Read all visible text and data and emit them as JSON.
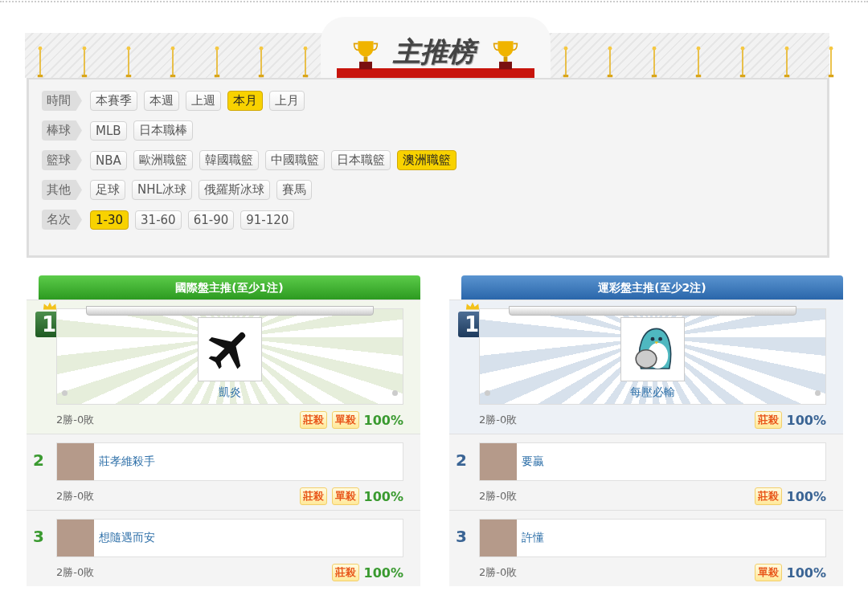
{
  "title": "主推榜",
  "filters": [
    {
      "label": "時間",
      "options": [
        {
          "label": "本賽季",
          "selected": false
        },
        {
          "label": "本週",
          "selected": false
        },
        {
          "label": "上週",
          "selected": false
        },
        {
          "label": "本月",
          "selected": true
        },
        {
          "label": "上月",
          "selected": false
        }
      ]
    },
    {
      "label": "棒球",
      "options": [
        {
          "label": "MLB",
          "selected": false
        },
        {
          "label": "日本職棒",
          "selected": false
        }
      ]
    },
    {
      "label": "籃球",
      "options": [
        {
          "label": "NBA",
          "selected": false
        },
        {
          "label": "歐洲職籃",
          "selected": false
        },
        {
          "label": "韓國職籃",
          "selected": false
        },
        {
          "label": "中國職籃",
          "selected": false
        },
        {
          "label": "日本職籃",
          "selected": false
        },
        {
          "label": "澳洲職籃",
          "selected": true
        }
      ]
    },
    {
      "label": "其他",
      "options": [
        {
          "label": "足球",
          "selected": false
        },
        {
          "label": "NHL冰球",
          "selected": false
        },
        {
          "label": "俄羅斯冰球",
          "selected": false
        },
        {
          "label": "賽馬",
          "selected": false
        }
      ]
    },
    {
      "label": "名次",
      "options": [
        {
          "label": "1-30",
          "selected": true
        },
        {
          "label": "31-60",
          "selected": false
        },
        {
          "label": "61-90",
          "selected": false
        },
        {
          "label": "91-120",
          "selected": false
        }
      ]
    }
  ],
  "boards": [
    {
      "kind": "green",
      "title": "國際盤主推(至少1注)",
      "entries": [
        {
          "rank": "1",
          "avatar": {
            "kind": "plane"
          },
          "name": "凱炎",
          "record": "2勝-0敗",
          "tags": [
            "莊殺",
            "單殺"
          ],
          "rate": "100%"
        },
        {
          "rank": "2",
          "avatar": {
            "kind": "photo"
          },
          "name": "莊孝維殺手",
          "record": "2勝-0敗",
          "tags": [
            "莊殺",
            "單殺"
          ],
          "rate": "100%"
        },
        {
          "rank": "3",
          "avatar": {
            "kind": "photo"
          },
          "name": "想隨遇而安",
          "record": "2勝-0敗",
          "tags": [
            "莊殺"
          ],
          "rate": "100%"
        }
      ]
    },
    {
      "kind": "blue",
      "title": "運彩盤主推(至少2注)",
      "entries": [
        {
          "rank": "1",
          "avatar": {
            "kind": "penguin"
          },
          "name": "每壓必輸",
          "record": "2勝-0敗",
          "tags": [
            "莊殺"
          ],
          "rate": "100%"
        },
        {
          "rank": "2",
          "avatar": {
            "kind": "photo"
          },
          "name": "要贏",
          "record": "2勝-0敗",
          "tags": [
            "莊殺"
          ],
          "rate": "100%"
        },
        {
          "rank": "3",
          "avatar": {
            "kind": "photo"
          },
          "name": "許懂",
          "record": "2勝-0敗",
          "tags": [
            "單殺"
          ],
          "rate": "100%"
        }
      ]
    }
  ]
}
